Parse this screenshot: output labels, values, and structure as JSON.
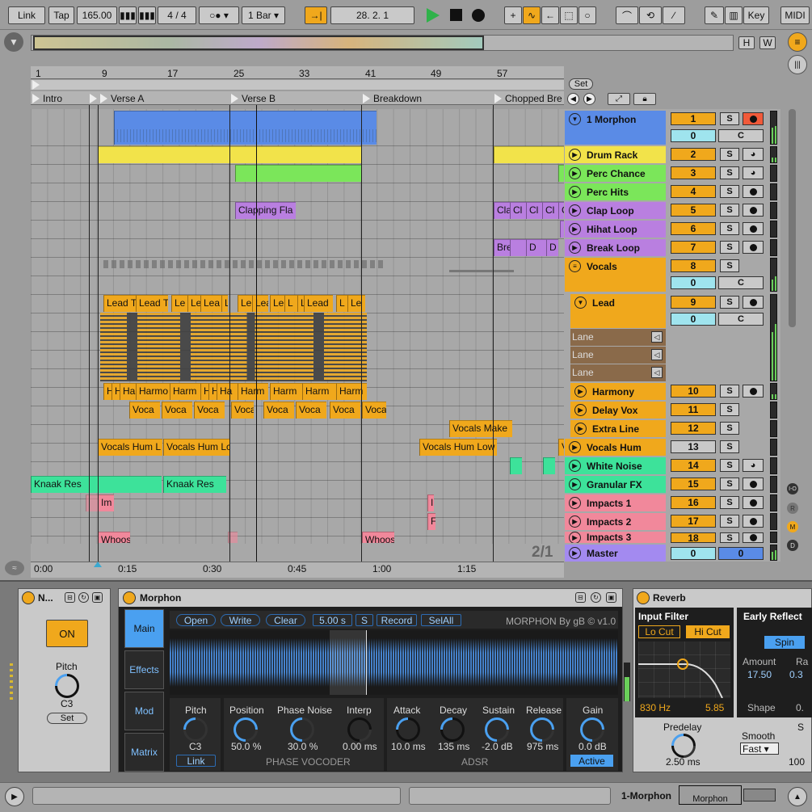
{
  "transport": {
    "link": "Link",
    "tap": "Tap",
    "tempo": "165.00",
    "signature_num": "4",
    "signature_div": "4",
    "quantize": "1 Bar",
    "position": "28.  2.  1",
    "key": "Key",
    "midi": "MIDI"
  },
  "overview": {
    "h": "H",
    "w": "W"
  },
  "ruler": {
    "bars": [
      "1",
      "9",
      "17",
      "25",
      "33",
      "41",
      "49",
      "57"
    ],
    "set": "Set"
  },
  "locators": [
    "Intro",
    "Verse A",
    "Verse B",
    "Breakdown",
    "Chopped Bre"
  ],
  "time_ruler": [
    "0:00",
    "0:15",
    "0:30",
    "0:45",
    "1:00",
    "1:15"
  ],
  "page_indicator": "2/1",
  "clips": {
    "drum": "",
    "clapping": "Clapping Fla",
    "lead": [
      "Lead T",
      "Lead T",
      "Le",
      "Le",
      "Lea",
      "L",
      "Le",
      "Lea",
      "Le",
      "L",
      "L",
      "Lead",
      "L",
      "Le"
    ],
    "harm": [
      "H",
      "H",
      "Ha",
      "Harmo",
      "Harm",
      "H",
      "H",
      "Ha",
      "Harm",
      "Harm",
      "Harm",
      "Harm"
    ],
    "voca": [
      "Voca",
      "Voca",
      "Voca",
      "Voca",
      "Voca",
      "Voca",
      "Voca",
      "Voca"
    ],
    "vocals_make": "Vocals Make",
    "hum": [
      "Vocals Hum L",
      "Vocals Hum Lc",
      "Vocals Hum Low",
      "V"
    ],
    "knaak": [
      "Knaak Res",
      "Knaak Res"
    ],
    "im": "Im",
    "i": "I",
    "f": "F",
    "whoos": [
      "Whoos",
      "Whoos"
    ],
    "chopped_cl": [
      "Cla",
      "Cl",
      "Cl",
      "Cl",
      "C"
    ],
    "break": [
      "Bre",
      "D",
      "D",
      "l"
    ]
  },
  "tracks": [
    {
      "name": "1 Morphon",
      "num": "1",
      "color": "#5a8be6"
    },
    {
      "name": "Drum Rack",
      "num": "2",
      "color": "#f2e34a"
    },
    {
      "name": "Perc Chance",
      "num": "3",
      "color": "#7be65a"
    },
    {
      "name": "Perc Hits",
      "num": "4",
      "color": "#7be65a"
    },
    {
      "name": "Clap Loop",
      "num": "5",
      "color": "#b97fe0"
    },
    {
      "name": "Hihat Loop",
      "num": "6",
      "color": "#b97fe0"
    },
    {
      "name": "Break Loop",
      "num": "7",
      "color": "#b97fe0"
    },
    {
      "name": "Vocals",
      "num": "8",
      "color": "#f0a81c"
    },
    {
      "name": "Lead",
      "num": "9",
      "color": "#f0a81c"
    },
    {
      "name": "Harmony",
      "num": "10",
      "color": "#f0a81c"
    },
    {
      "name": "Delay Vox",
      "num": "11",
      "color": "#f0a81c"
    },
    {
      "name": "Extra Line",
      "num": "12",
      "color": "#f0a81c"
    },
    {
      "name": "Vocals Hum",
      "num": "13",
      "color": "#f0a81c"
    },
    {
      "name": "White Noise",
      "num": "14",
      "color": "#3de29a"
    },
    {
      "name": "Granular FX",
      "num": "15",
      "color": "#3de29a"
    },
    {
      "name": "Impacts 1",
      "num": "16",
      "color": "#f1889b"
    },
    {
      "name": "Impacts 2",
      "num": "17",
      "color": "#f1889b"
    },
    {
      "name": "Impacts 3",
      "num": "18",
      "color": "#f1889b"
    },
    {
      "name": "Master",
      "num": "0",
      "color": "#a38af0"
    }
  ],
  "mixer": {
    "s": "S",
    "c": "C",
    "zero": "0",
    "lane": "Lane"
  },
  "side_letters": [
    "I-O",
    "R",
    "M",
    "D"
  ],
  "device1": {
    "title": "N...",
    "on": "ON",
    "pitch": "Pitch",
    "pitch_val": "C3",
    "set": "Set"
  },
  "morphon": {
    "title": "Morphon",
    "tabs": [
      "Main",
      "Effects",
      "Mod",
      "Matrix"
    ],
    "open": "Open",
    "write": "Write",
    "clear": "Clear",
    "time": "5.00 s",
    "s": "S",
    "record": "Record",
    "selall": "SelAll",
    "brand": "MORPHON By gB © v1.0",
    "pitch": "Pitch",
    "pitch_val": "C3",
    "link": "Link",
    "position": "Position",
    "position_val": "50.0 %",
    "phase_noise": "Phase Noise",
    "phase_noise_val": "30.0 %",
    "interp": "Interp",
    "interp_val": "0.00 ms",
    "section_pv": "PHASE VOCODER",
    "attack": "Attack",
    "attack_val": "10.0 ms",
    "decay": "Decay",
    "decay_val": "135 ms",
    "sustain": "Sustain",
    "sustain_val": "-2.0 dB",
    "release": "Release",
    "release_val": "975 ms",
    "section_adsr": "ADSR",
    "gain": "Gain",
    "gain_val": "0.0 dB",
    "active": "Active"
  },
  "reverb": {
    "title": "Reverb",
    "input_filter": "Input Filter",
    "lo_cut": "Lo Cut",
    "hi_cut": "Hi Cut",
    "freq": "830 Hz",
    "q": "5.85",
    "early": "Early Reflect",
    "spin": "Spin",
    "amount": "Amount",
    "amount_val": "17.50",
    "ra": "Ra",
    "ra_val": "0.3",
    "amount2_val": "0.3",
    "shape": "Shape",
    "shape_val": "0.",
    "predelay": "Predelay",
    "predelay_val": "2.50 ms",
    "smooth": "Smooth",
    "smooth_val": "Fast",
    "s_label": "S",
    "s_val": "100"
  },
  "status": {
    "track": "1-Morphon",
    "device": "Morphon"
  }
}
